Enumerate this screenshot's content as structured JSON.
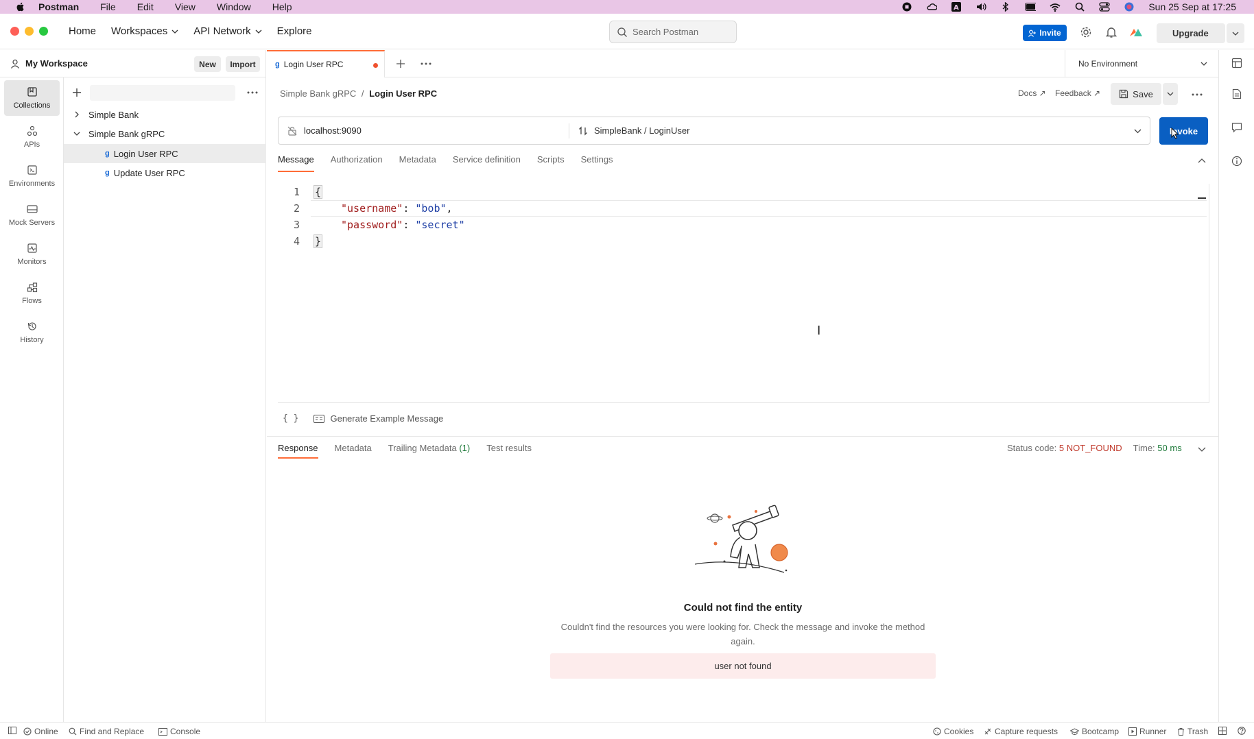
{
  "menubar": {
    "app": "Postman",
    "items": [
      "File",
      "Edit",
      "View",
      "Window",
      "Help"
    ],
    "clock": "Sun 25 Sep at 17:25"
  },
  "header": {
    "nav": [
      "Home",
      "Workspaces",
      "API Network",
      "Explore"
    ],
    "search_placeholder": "Search Postman",
    "invite_label": "Invite",
    "upgrade_label": "Upgrade"
  },
  "workspace": {
    "title": "My Workspace",
    "new_label": "New",
    "import_label": "Import"
  },
  "rail": {
    "items": [
      "Collections",
      "APIs",
      "Environments",
      "Mock Servers",
      "Monitors",
      "Flows",
      "History"
    ]
  },
  "collections": {
    "tree": [
      {
        "label": "Simple Bank"
      },
      {
        "label": "Simple Bank gRPC"
      },
      {
        "label": "Login User RPC"
      },
      {
        "label": "Update User RPC"
      }
    ]
  },
  "tabs": {
    "active": "Login User RPC",
    "environment": "No Environment"
  },
  "request": {
    "breadcrumb_parent": "Simple Bank gRPC",
    "breadcrumb_sep": "/",
    "breadcrumb_current": "Login User RPC",
    "docs_label": "Docs ↗",
    "feedback_label": "Feedback ↗",
    "save_label": "Save",
    "url": "localhost:9090",
    "method": "SimpleBank / LoginUser",
    "invoke_label": "Invoke",
    "subtabs": [
      "Message",
      "Authorization",
      "Metadata",
      "Service definition",
      "Scripts",
      "Settings"
    ],
    "code": {
      "line_numbers": [
        "1",
        "2",
        "3",
        "4"
      ],
      "open": "{",
      "key1": "\"username\"",
      "val1": "\"bob\"",
      "key2": "\"password\"",
      "val2": "\"secret\"",
      "close": "}"
    },
    "generate_label": "Generate Example Message"
  },
  "response": {
    "tabs": [
      "Response",
      "Metadata",
      "Trailing Metadata",
      "Test results"
    ],
    "trailing_count": "(1)",
    "status_label": "Status code:",
    "status_value": "5 NOT_FOUND",
    "time_label": "Time:",
    "time_value": "50 ms",
    "empty_title": "Could not find the entity",
    "empty_desc": "Couldn't find the resources you were looking for. Check the message and invoke the method again.",
    "error_message": "user not found"
  },
  "footer": {
    "online": "Online",
    "find_replace": "Find and Replace",
    "console": "Console",
    "cookies": "Cookies",
    "capture": "Capture requests",
    "bootcamp": "Bootcamp",
    "runner": "Runner",
    "trash": "Trash"
  },
  "colors": {
    "accent": "#ff6c37",
    "primary": "#0265d2",
    "error": "#c0392b",
    "success": "#1e7a3a"
  }
}
